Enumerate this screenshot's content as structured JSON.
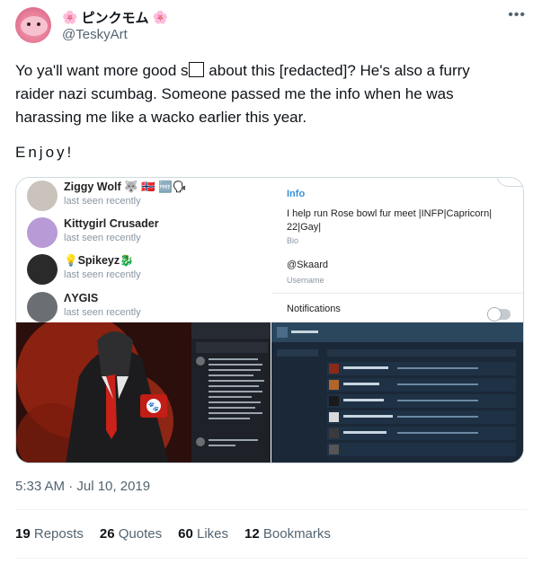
{
  "author": {
    "display_name": "ピンクモム",
    "handle": "@TeskyArt",
    "flower_emoji": "🌸"
  },
  "tweet": {
    "line1_a": "Yo ya'll want more good s",
    "line1_b": "about this [redacted]? He's also a furry",
    "line2": "raider nazi scumbag. Someone passed me the info when he was",
    "line3": "harassing me like a wacko earlier this year.",
    "enjoy": "Enjoy!"
  },
  "media": {
    "contacts": [
      {
        "name": "Ziggy Wolf 🐺 🇳🇴 🆓🗣",
        "status": "last seen recently",
        "avatar_color": "#c9c3bb"
      },
      {
        "name": "Kittygirl Crusader",
        "status": "last seen recently",
        "avatar_color": "#b89ad6"
      },
      {
        "name": "💡Spikeyz🐉",
        "status": "last seen recently",
        "avatar_color": "#d6b23a"
      },
      {
        "name": "ΛYGIS",
        "status": "last seen recently",
        "avatar_color": "#6b6f74"
      }
    ],
    "profile": {
      "info_heading": "Info",
      "bio": "I help run Rose bowl fur meet |INFP|Capricorn| 22|Gay|",
      "bio_label": "Bio",
      "username": "@Skaard",
      "username_label": "Username",
      "notifications": "Notifications"
    }
  },
  "meta": {
    "timestamp": "5:33 AM · Jul 10, 2019"
  },
  "stats": {
    "reposts_count": "19",
    "reposts_label": "Reposts",
    "quotes_count": "26",
    "quotes_label": "Quotes",
    "likes_count": "60",
    "likes_label": "Likes",
    "bookmarks_count": "12",
    "bookmarks_label": "Bookmarks"
  },
  "more_icon": "more-horizontal-icon"
}
